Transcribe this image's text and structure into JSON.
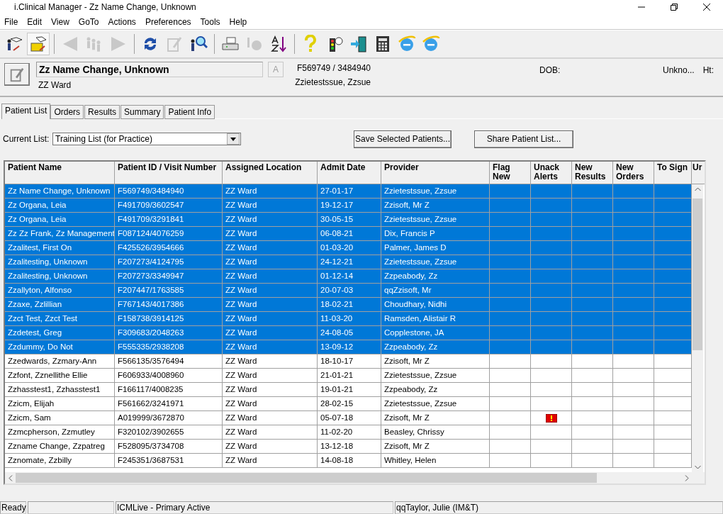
{
  "window": {
    "title": "i.Clinical Manager - Zz Name Change, Unknown"
  },
  "menu": [
    "File",
    "Edit",
    "View",
    "GoTo",
    "Actions",
    "Preferences",
    "Tools",
    "Help"
  ],
  "toolbar": [
    {
      "kind": "patient-list",
      "disabled": false,
      "selected": false
    },
    {
      "kind": "folder",
      "disabled": false,
      "selected": true
    },
    {
      "kind": "sep"
    },
    {
      "kind": "back",
      "disabled": true,
      "selected": false
    },
    {
      "kind": "people",
      "disabled": true,
      "selected": false
    },
    {
      "kind": "forward",
      "disabled": true,
      "selected": false
    },
    {
      "kind": "sep"
    },
    {
      "kind": "refresh",
      "disabled": false,
      "selected": false
    },
    {
      "kind": "edit",
      "disabled": true,
      "selected": false
    },
    {
      "kind": "search",
      "disabled": false,
      "selected": false
    },
    {
      "kind": "sep"
    },
    {
      "kind": "print",
      "disabled": false,
      "selected": false
    },
    {
      "kind": "record",
      "disabled": true,
      "selected": false
    },
    {
      "kind": "sort",
      "disabled": false,
      "selected": false
    },
    {
      "kind": "sep"
    },
    {
      "kind": "help",
      "disabled": false,
      "selected": false
    },
    {
      "kind": "traffic",
      "disabled": false,
      "selected": false
    },
    {
      "kind": "exit",
      "disabled": false,
      "selected": false
    },
    {
      "kind": "calculator",
      "disabled": false,
      "selected": false
    },
    {
      "kind": "browser",
      "disabled": false,
      "selected": false
    },
    {
      "kind": "browser",
      "disabled": false,
      "selected": false
    }
  ],
  "patient_header": {
    "name": "Zz Name Change, Unknown",
    "location": "ZZ Ward",
    "alert_button": "A",
    "ids": "F569749 / 3484940",
    "provider": "Zzietestssue, Zzsue",
    "dob_label": "DOB:",
    "sex": "Unkno...",
    "height_label": "Ht:"
  },
  "tabs": [
    {
      "label": "Patient List",
      "selected": true
    },
    {
      "label": "Orders",
      "selected": false
    },
    {
      "label": "Results",
      "selected": false
    },
    {
      "label": "Summary",
      "selected": false
    },
    {
      "label": "Patient Info",
      "selected": false
    }
  ],
  "current_list": {
    "label": "Current List:",
    "value": "Training List (for Practice)"
  },
  "buttons": [
    "Save Selected Patients...",
    "Share Patient List..."
  ],
  "table": {
    "columns": [
      "Patient Name",
      "Patient ID / Visit Number",
      "Assigned Location",
      "Admit Date",
      "Provider",
      "Flag New",
      "Unack Alerts",
      "New Results",
      "New Orders",
      "To Sign",
      "Ur"
    ],
    "rows": [
      {
        "cells": [
          "Zz Name Change, Unknown",
          "F569749/3484940",
          "ZZ Ward",
          "27-01-17",
          "Zzietestssue, Zzsue"
        ],
        "selected": true,
        "unack_alert": false
      },
      {
        "cells": [
          "Zz Organa, Leia",
          "F491709/3602547",
          "ZZ Ward",
          "19-12-17",
          "Zzisoft, Mr Z"
        ],
        "selected": true,
        "unack_alert": false
      },
      {
        "cells": [
          "Zz Organa, Leia",
          "F491709/3291841",
          "ZZ Ward",
          "30-05-15",
          "Zzietestssue, Zzsue"
        ],
        "selected": true,
        "unack_alert": false
      },
      {
        "cells": [
          "Zz Zz Frank, Zz Management",
          "F087124/4076259",
          "ZZ Ward",
          "06-08-21",
          "Dix, Francis P"
        ],
        "selected": true,
        "unack_alert": false
      },
      {
        "cells": [
          "Zzalitest, First On",
          "F425526/3954666",
          "ZZ Ward",
          "01-03-20",
          "Palmer, James D"
        ],
        "selected": true,
        "unack_alert": false
      },
      {
        "cells": [
          "Zzalitesting, Unknown",
          "F207273/4124795",
          "ZZ Ward",
          "24-12-21",
          "Zzietestssue, Zzsue"
        ],
        "selected": true,
        "unack_alert": false
      },
      {
        "cells": [
          "Zzalitesting, Unknown",
          "F207273/3349947",
          "ZZ Ward",
          "01-12-14",
          "Zzpeabody, Zz"
        ],
        "selected": true,
        "unack_alert": false
      },
      {
        "cells": [
          "Zzallyton, Alfonso",
          "F207447/1763585",
          "ZZ Ward",
          "20-07-03",
          "qqZzisoft, Mr"
        ],
        "selected": true,
        "unack_alert": false
      },
      {
        "cells": [
          "Zzaxe, Zzlillian",
          "F767143/4017386",
          "ZZ Ward",
          "18-02-21",
          "Choudhary, Nidhi"
        ],
        "selected": true,
        "unack_alert": false
      },
      {
        "cells": [
          "Zzct Test, Zzct Test",
          "F158738/3914125",
          "ZZ Ward",
          "11-03-20",
          "Ramsden, Alistair R"
        ],
        "selected": true,
        "unack_alert": false
      },
      {
        "cells": [
          "Zzdetest, Greg",
          "F309683/2048263",
          "ZZ Ward",
          "24-08-05",
          "Copplestone, JA"
        ],
        "selected": true,
        "unack_alert": false
      },
      {
        "cells": [
          "Zzdummy, Do Not",
          "F555335/2938208",
          "ZZ Ward",
          "13-09-12",
          "Zzpeabody, Zz"
        ],
        "selected": true,
        "unack_alert": false
      },
      {
        "cells": [
          "Zzedwards, Zzmary-Ann",
          "F566135/3576494",
          "ZZ Ward",
          "18-10-17",
          "Zzisoft, Mr Z"
        ],
        "selected": false,
        "unack_alert": false
      },
      {
        "cells": [
          "Zzfont, Zznellithe Ellie",
          "F606933/4008960",
          "ZZ Ward",
          "21-01-21",
          "Zzietestssue, Zzsue"
        ],
        "selected": false,
        "unack_alert": false
      },
      {
        "cells": [
          "Zzhasstest1, Zzhasstest1",
          "F166117/4008235",
          "ZZ Ward",
          "19-01-21",
          "Zzpeabody, Zz"
        ],
        "selected": false,
        "unack_alert": false
      },
      {
        "cells": [
          "Zzicm, Elijah",
          "F561662/3241971",
          "ZZ Ward",
          "28-02-15",
          "Zzietestssue, Zzsue"
        ],
        "selected": false,
        "unack_alert": false
      },
      {
        "cells": [
          "Zzicm, Sam",
          "A019999/3672870",
          "ZZ Ward",
          "05-07-18",
          "Zzisoft, Mr Z"
        ],
        "selected": false,
        "unack_alert": true
      },
      {
        "cells": [
          "Zzmcpherson, Zzmutley",
          "F320102/3902655",
          "ZZ Ward",
          "11-02-20",
          "Beasley, Chrissy"
        ],
        "selected": false,
        "unack_alert": false
      },
      {
        "cells": [
          "Zzname Change, Zzpatreg",
          "F528095/3734708",
          "ZZ Ward",
          "13-12-18",
          "Zzisoft, Mr Z"
        ],
        "selected": false,
        "unack_alert": false
      },
      {
        "cells": [
          "Zznomate, Zzbilly",
          "F245351/3687531",
          "ZZ Ward",
          "14-08-18",
          "Whitley, Helen"
        ],
        "selected": false,
        "unack_alert": false
      }
    ]
  },
  "status_bar": [
    "Ready",
    "ICMLive - Primary Active",
    "qqTaylor, Julie (IM&T)"
  ]
}
